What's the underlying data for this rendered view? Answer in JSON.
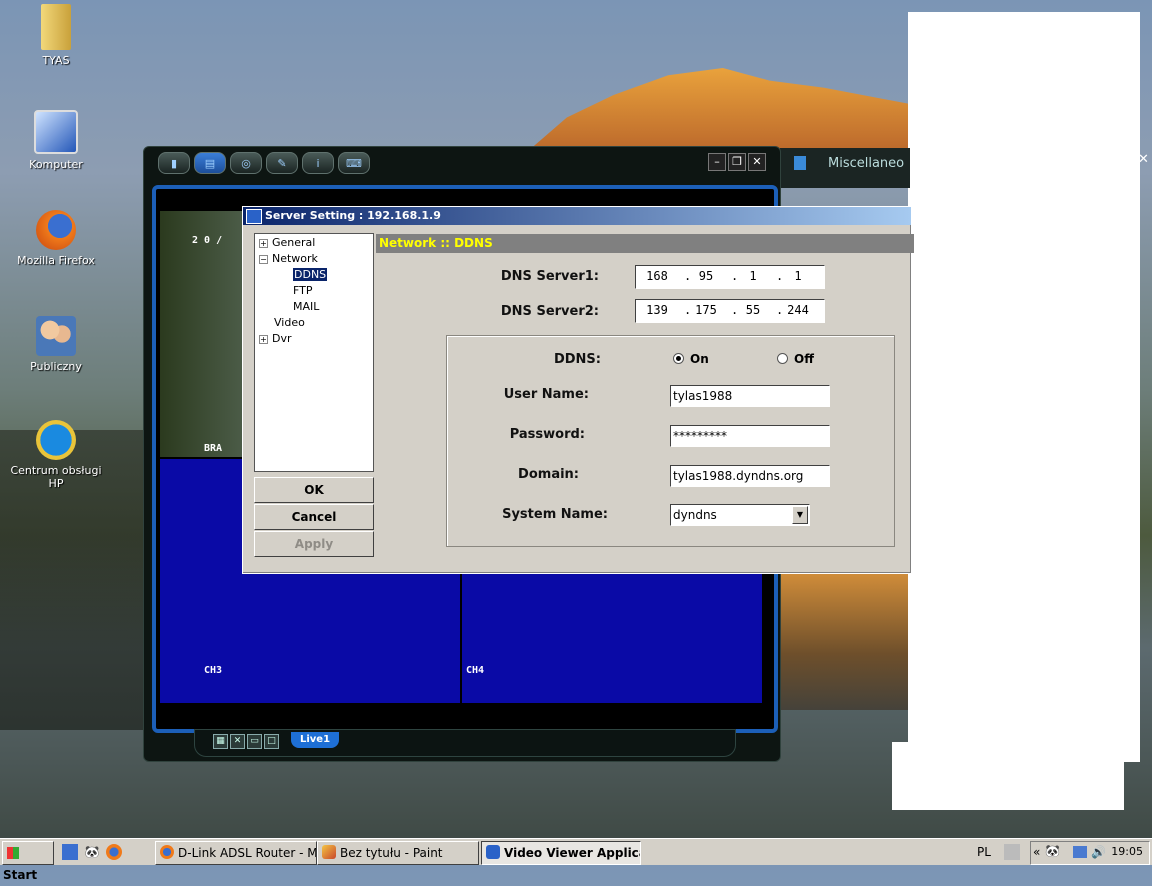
{
  "desktop": {
    "icons": [
      {
        "label": "TYAS",
        "icon": "folder-icon"
      },
      {
        "label": "Komputer",
        "icon": "computer-icon"
      },
      {
        "label": "Mozilla Firefox",
        "icon": "firefox-icon"
      },
      {
        "label": "Publiczny",
        "icon": "users-icon"
      },
      {
        "label": "Centrum obsługi HP",
        "icon": "hp-icon"
      }
    ]
  },
  "viewer": {
    "toolbar_icons": [
      "record-icon",
      "document-icon",
      "network-icon",
      "tools-icon",
      "info-icon",
      "keyboard-icon"
    ],
    "minimize": "–",
    "maximize": "❐",
    "close": "✕",
    "cameras": {
      "ch3": "CH3",
      "ch4": "CH4",
      "ch1_osd": "2 0 /",
      "ch1_osd2": "BRA"
    },
    "live_tab": "Live1",
    "misc_window_title": "Miscellaneo",
    "misc_close": "✕"
  },
  "dialog": {
    "title": "Server Setting : 192.168.1.9",
    "tree": {
      "general": "General",
      "network": "Network",
      "ddns": "DDNS",
      "ftp": "FTP",
      "mail": "MAIL",
      "video": "Video",
      "dvr": "Dvr",
      "plus": "+",
      "minus": "−"
    },
    "buttons": {
      "ok": "OK",
      "cancel": "Cancel",
      "apply": "Apply"
    },
    "section_title": "Network :: DDNS",
    "dns1_label": "DNS Server1:",
    "dns1": [
      "168",
      "95",
      "1",
      "1"
    ],
    "dns2_label": "DNS Server2:",
    "dns2": [
      "139",
      "175",
      "55",
      "244"
    ],
    "ip_dot": ".",
    "ddns_label": "DDNS:",
    "ddns_on": "On",
    "ddns_off": "Off",
    "ddns_selected": "On",
    "username_label": "User Name:",
    "username": "tylas1988",
    "password_label": "Password:",
    "password": "*********",
    "domain_label": "Domain:",
    "domain": "tylas1988.dyndns.org",
    "system_name_label": "System Name:",
    "system_name": "dyndns",
    "select_arrow": "▼"
  },
  "taskbar": {
    "start": "Start",
    "tasks": [
      {
        "label": "D-Link ADSL Router - Mo...",
        "icon": "firefox-icon",
        "active": false
      },
      {
        "label": "Bez tytułu - Paint",
        "icon": "paint-icon",
        "active": false
      },
      {
        "label": "Video Viewer Applicat...",
        "icon": "viewer-icon",
        "active": true
      }
    ],
    "language": "PL",
    "chevron": "«",
    "clock": "19:05"
  },
  "colors": {
    "accent_blue": "#1c5fb8",
    "camera_blue": "#0a0aa6",
    "section_yellow": "#ffff00",
    "title_bar": "#0a246a"
  }
}
